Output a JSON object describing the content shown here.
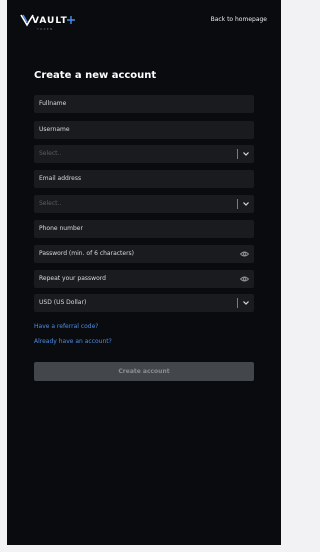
{
  "brand": {
    "name": "VAULT",
    "tagline": "TOKEN"
  },
  "header": {
    "back_link": "Back to homepage"
  },
  "form": {
    "title": "Create a new account",
    "fields": {
      "fullname": "Fullname",
      "username": "Username",
      "select_1": "Select..",
      "email": "Email address",
      "select_2": "Select..",
      "phone": "Phone number",
      "password": "Password (min. of 6 characters)",
      "repeat_password": "Repeat your password",
      "currency": "USD (US Dollar)"
    },
    "links": {
      "referral": "Have a referral code?",
      "have_account": "Already have an account?"
    },
    "submit_label": "Create account"
  },
  "colors": {
    "background": "#090b0e",
    "field": "#1a1b1f",
    "link": "#4a8fe8",
    "button": "#43464b"
  }
}
